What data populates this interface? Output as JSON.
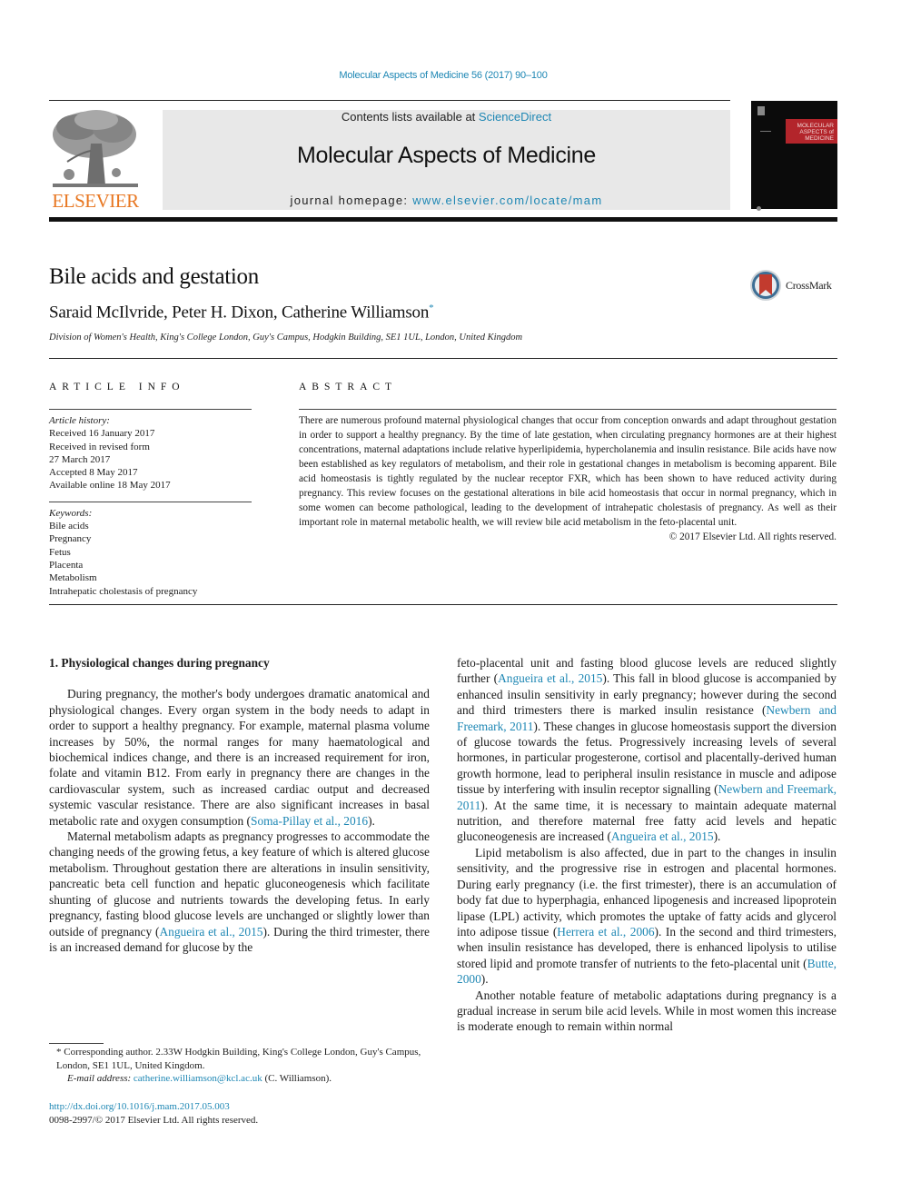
{
  "header": {
    "journal_reference": "Molecular Aspects of Medicine 56 (2017) 90–100",
    "contents_prefix": "Contents lists available at ",
    "contents_link": "ScienceDirect",
    "journal_title": "Molecular Aspects of Medicine",
    "homepage_prefix": "journal homepage: ",
    "homepage_link": "www.elsevier.com/locate/mam",
    "publisher_logo_text": "ELSEVIER",
    "publisher_logo_icon": "elsevier-tree-icon",
    "cover_title_lines": [
      "MOLECULAR",
      "ASPECTS of",
      "MEDICINE"
    ],
    "colors": {
      "link": "#1e87b4",
      "elsevier_orange": "#e87722",
      "cover_red": "#b3252b",
      "masthead_bg": "#e8e8e8"
    }
  },
  "article": {
    "title": "Bile acids and gestation",
    "authors": "Saraid McIlvride, Peter H. Dixon, Catherine Williamson",
    "corresponding_marker": "*",
    "affiliation": "Division of Women's Health, King's College London, Guy's Campus, Hodgkin Building, SE1 1UL, London, United Kingdom",
    "crossmark_label": "CrossMark"
  },
  "article_info": {
    "heading": "ARTICLE INFO",
    "history_label": "Article history:",
    "history": [
      "Received 16 January 2017",
      "Received in revised form",
      "27 March 2017",
      "Accepted 8 May 2017",
      "Available online 18 May 2017"
    ],
    "keywords_label": "Keywords:",
    "keywords": [
      "Bile acids",
      "Pregnancy",
      "Fetus",
      "Placenta",
      "Metabolism",
      "Intrahepatic cholestasis of pregnancy"
    ]
  },
  "abstract": {
    "heading": "ABSTRACT",
    "text": "There are numerous profound maternal physiological changes that occur from conception onwards and adapt throughout gestation in order to support a healthy pregnancy. By the time of late gestation, when circulating pregnancy hormones are at their highest concentrations, maternal adaptations include relative hyperlipidemia, hypercholanemia and insulin resistance. Bile acids have now been established as key regulators of metabolism, and their role in gestational changes in metabolism is becoming apparent. Bile acid homeostasis is tightly regulated by the nuclear receptor FXR, which has been shown to have reduced activity during pregnancy. This review focuses on the gestational alterations in bile acid homeostasis that occur in normal pregnancy, which in some women can become pathological, leading to the development of intrahepatic cholestasis of pregnancy. As well as their important role in maternal metabolic health, we will review bile acid metabolism in the feto-placental unit.",
    "copyright": "© 2017 Elsevier Ltd. All rights reserved."
  },
  "body": {
    "section_heading": "1.  Physiological changes during pregnancy",
    "left_paragraphs": [
      [
        {
          "t": "During pregnancy, the mother's body undergoes dramatic anatomical and physiological changes. Every organ system in the body needs to adapt in order to support a healthy pregnancy. For example, maternal plasma volume increases by 50%, the normal ranges for many haematological and biochemical indices change, and there is an increased requirement for iron, folate and vitamin B12. From early in pregnancy there are changes in the cardiovascular system, such as increased cardiac output and decreased systemic vascular resistance. There are also significant increases in basal metabolic rate and oxygen consumption ("
        },
        {
          "t": "Soma-Pillay et al., 2016",
          "link": true
        },
        {
          "t": ")."
        }
      ],
      [
        {
          "t": "Maternal metabolism adapts as pregnancy progresses to accommodate the changing needs of the growing fetus, a key feature of which is altered glucose metabolism. Throughout gestation there are alterations in insulin sensitivity, pancreatic beta cell function and hepatic gluconeogenesis which facilitate shunting of glucose and nutrients towards the developing fetus. In early pregnancy, fasting blood glucose levels are unchanged or slightly lower than outside of pregnancy ("
        },
        {
          "t": "Angueira et al., 2015",
          "link": true
        },
        {
          "t": "). During the third trimester, there is an increased demand for glucose by the"
        }
      ]
    ],
    "right_paragraphs": [
      [
        {
          "t": "feto-placental unit and fasting blood glucose levels are reduced slightly further ("
        },
        {
          "t": "Angueira et al., 2015",
          "link": true
        },
        {
          "t": "). This fall in blood glucose is accompanied by enhanced insulin sensitivity in early pregnancy; however during the second and third trimesters there is marked insulin resistance ("
        },
        {
          "t": "Newbern and Freemark, 2011",
          "link": true
        },
        {
          "t": "). These changes in glucose homeostasis support the diversion of glucose towards the fetus. Progressively increasing levels of several hormones, in particular progesterone, cortisol and placentally-derived human growth hormone, lead to peripheral insulin resistance in muscle and adipose tissue by interfering with insulin receptor signalling ("
        },
        {
          "t": "Newbern and Freemark, 2011",
          "link": true
        },
        {
          "t": "). At the same time, it is necessary to maintain adequate maternal nutrition, and therefore maternal free fatty acid levels and hepatic gluconeogenesis are increased ("
        },
        {
          "t": "Angueira et al., 2015",
          "link": true
        },
        {
          "t": ")."
        }
      ],
      [
        {
          "t": "Lipid metabolism is also affected, due in part to the changes in insulin sensitivity, and the progressive rise in estrogen and placental hormones. During early pregnancy (i.e. the first trimester), there is an accumulation of body fat due to hyperphagia, enhanced lipogenesis and increased lipoprotein lipase (LPL) activity, which promotes the uptake of fatty acids and glycerol into adipose tissue ("
        },
        {
          "t": "Herrera et al., 2006",
          "link": true
        },
        {
          "t": "). In the second and third trimesters, when insulin resistance has developed, there is enhanced lipolysis to utilise stored lipid and promote transfer of nutrients to the feto-placental unit ("
        },
        {
          "t": "Butte, 2000",
          "link": true
        },
        {
          "t": ")."
        }
      ],
      [
        {
          "t": "Another notable feature of metabolic adaptations during pregnancy is a gradual increase in serum bile acid levels. While in most women this increase is moderate enough to remain within normal"
        }
      ]
    ]
  },
  "footnote": {
    "marker": "*",
    "corresponding": " Corresponding author. 2.33W Hodgkin Building, King's College London, Guy's Campus, London, SE1 1UL, United Kingdom.",
    "email_label": "E-mail address: ",
    "email": "catherine.williamson@kcl.ac.uk",
    "email_suffix": " (C. Williamson)."
  },
  "doi": {
    "link": "http://dx.doi.org/10.1016/j.mam.2017.05.003",
    "issn_line": "0098-2997/© 2017 Elsevier Ltd. All rights reserved."
  }
}
